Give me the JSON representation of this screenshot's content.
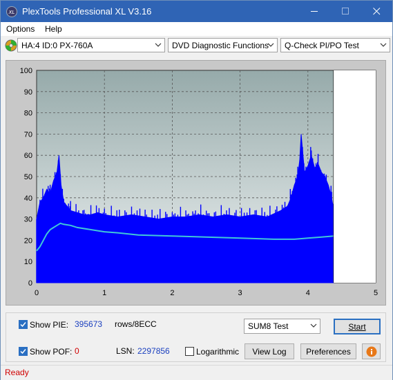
{
  "window": {
    "title": "PlexTools Professional XL V3.16",
    "icon_text": "XL",
    "minimize_icon": "minimize-icon",
    "maximize_icon": "maximize-icon",
    "close_icon": "close-icon"
  },
  "menu": {
    "items": [
      "Options",
      "Help"
    ]
  },
  "toolbar": {
    "drive": "HA:4 ID:0  PX-760A",
    "function": "DVD Diagnostic Functions",
    "test": "Q-Check PI/PO Test"
  },
  "chart_data": {
    "type": "area",
    "title": "",
    "xlabel": "",
    "ylabel": "",
    "xlim": [
      0,
      5
    ],
    "ylim": [
      0,
      100
    ],
    "x_ticks": [
      "0",
      "1",
      "2",
      "3",
      "4",
      "5"
    ],
    "y_ticks": [
      "0",
      "10",
      "20",
      "30",
      "40",
      "50",
      "60",
      "70",
      "80",
      "90",
      "100"
    ],
    "grid": true,
    "end_marker_x": 4.38,
    "series": [
      {
        "color": "#0000ff",
        "x": [
          0.0,
          0.05,
          0.1,
          0.15,
          0.2,
          0.25,
          0.3,
          0.33,
          0.36,
          0.4,
          0.45,
          0.5,
          0.6,
          0.7,
          0.8,
          0.9,
          1.0,
          1.2,
          1.4,
          1.6,
          1.8,
          2.0,
          2.2,
          2.4,
          2.6,
          2.8,
          3.0,
          3.2,
          3.4,
          3.6,
          3.7,
          3.75,
          3.8,
          3.85,
          3.88,
          3.9,
          3.95,
          4.0,
          4.05,
          4.1,
          4.15,
          4.2,
          4.25,
          4.3,
          4.35,
          4.38
        ],
        "values": [
          30,
          38,
          40,
          44,
          42,
          48,
          52,
          60,
          46,
          38,
          36,
          34,
          33,
          32,
          32,
          33,
          32,
          31,
          32,
          31,
          30,
          31,
          31,
          32,
          31,
          32,
          31,
          32,
          31,
          34,
          36,
          40,
          46,
          50,
          58,
          70,
          52,
          55,
          60,
          54,
          56,
          52,
          50,
          46,
          40,
          34
        ]
      },
      {
        "color": "#40c8d8",
        "x": [
          0.0,
          0.05,
          0.1,
          0.15,
          0.2,
          0.25,
          0.3,
          0.35,
          0.4,
          0.5,
          0.6,
          0.8,
          1.0,
          1.2,
          1.5,
          2.0,
          2.5,
          3.0,
          3.5,
          3.8,
          4.0,
          4.2,
          4.38
        ],
        "values": [
          15,
          17,
          20,
          23,
          25,
          26,
          27,
          28,
          27.5,
          27,
          26,
          25,
          24,
          23.5,
          22.5,
          22,
          21.5,
          21,
          20.5,
          20.5,
          21,
          21.5,
          22
        ]
      }
    ]
  },
  "controls": {
    "show_pie_label": "Show PIE:",
    "pie_value": "395673",
    "pie_unit": "rows/8ECC",
    "show_pof_label": "Show POF:",
    "pof_value": "0",
    "lsn_label": "LSN:",
    "lsn_value": "2297856",
    "logarithmic_label": "Logarithmic",
    "test_mode": "SUM8 Test",
    "start_button": "Start",
    "view_log_button": "View Log",
    "preferences_button": "Preferences",
    "info_icon": "info-icon"
  },
  "status": {
    "text": "Ready"
  }
}
